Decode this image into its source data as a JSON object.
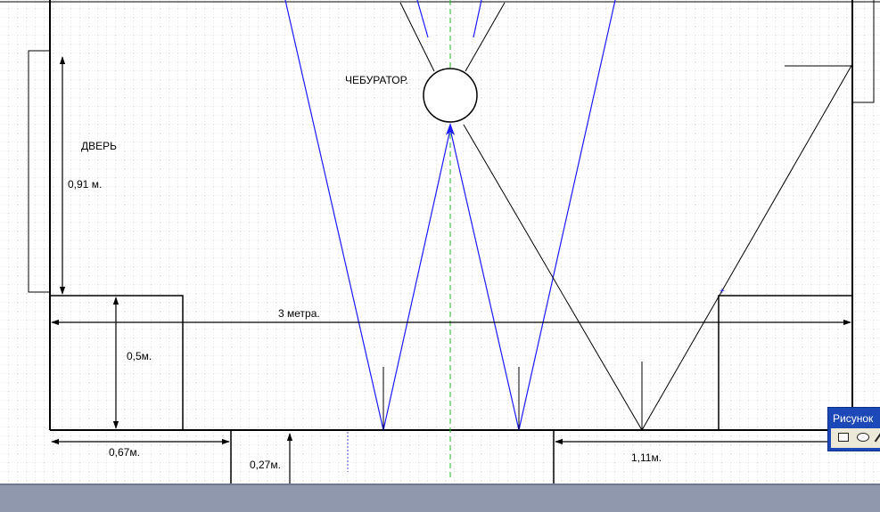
{
  "labels": {
    "cheburator": "ЧЕБУРАТОР.",
    "door": "ДВЕРЬ",
    "door_width": "0,91 м.",
    "room_width": "3 метра.",
    "ledge_depth": "0,5м.",
    "left_offset": "0,67м.",
    "niche_depth": "0,27м.",
    "right_offset": "1,11м."
  },
  "toolbar": {
    "title": "Рисунок",
    "tools": [
      "rectangle-tool",
      "ellipse-tool",
      "line-tool"
    ]
  },
  "colors": {
    "walls": "#000000",
    "reflection_rays": "#1a1aff",
    "axis": "#22bb22",
    "grid": "#b8b8b8",
    "toolbar": "#1c48b8",
    "status_strip": "#8f98ad"
  }
}
